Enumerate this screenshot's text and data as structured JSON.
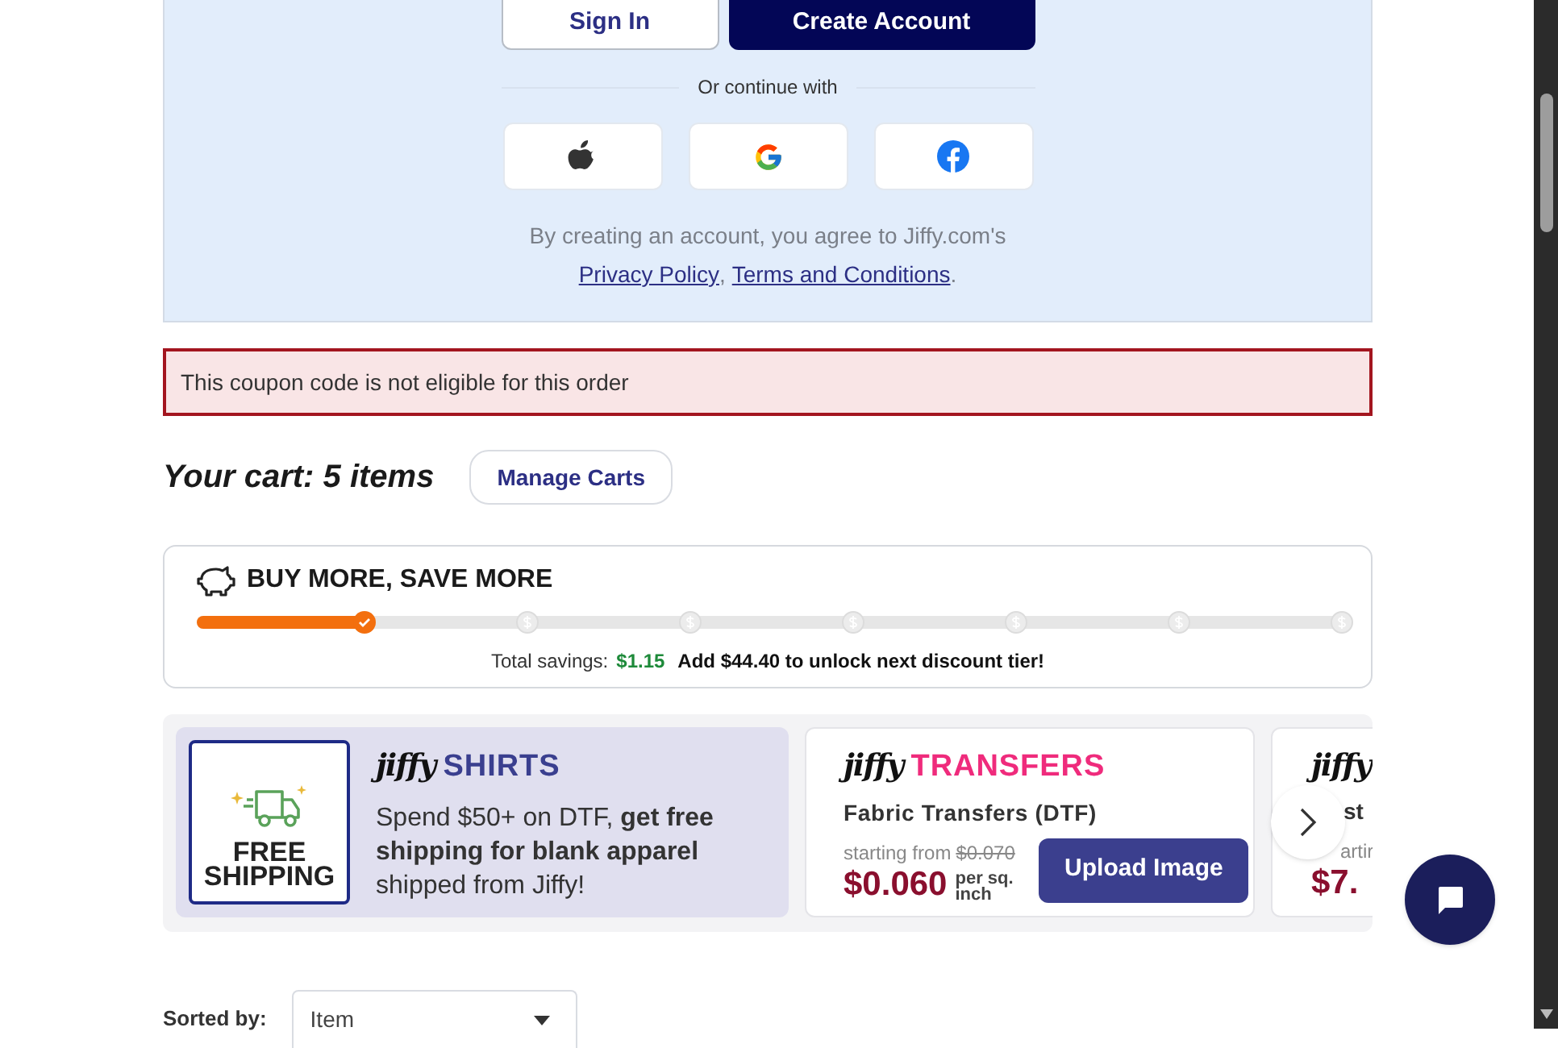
{
  "auth_panel": {
    "buttons": [
      {
        "label": "Sign In",
        "kind": "secondary"
      },
      {
        "label": "Create Account",
        "kind": "primary"
      }
    ],
    "divider_text": "Or continue with",
    "social_buttons": [
      {
        "kind": "apple"
      },
      {
        "kind": "google"
      },
      {
        "kind": "facebook"
      }
    ],
    "terms": {
      "text": "By creating an account, you agree to Jiffy.com's",
      "links": [
        "Privacy Policy",
        "Terms and Conditions"
      ],
      "separator": ",",
      "end": "."
    }
  },
  "coupon_error": "This coupon code is not eligible for this order",
  "cart": {
    "title": "Your cart: 5 items",
    "manage_button": "Manage Carts"
  },
  "savings": {
    "title": "BUY MORE, SAVE MORE",
    "level": 0.146,
    "tiers": [
      {
        "reached": true
      },
      {
        "reached": false
      },
      {
        "reached": false
      },
      {
        "reached": false
      },
      {
        "reached": false
      },
      {
        "reached": false
      },
      {
        "reached": false
      }
    ],
    "total_label": "Total savings:",
    "total_value": "$1.15",
    "next_tier": "Add $44.40 to unlock next discount tier!"
  },
  "promos": [
    {
      "kind": "shipping",
      "badge": [
        "FREE",
        "SHIPPING"
      ],
      "brand": "jiffy",
      "product": "SHIRTS",
      "text": "Spend $50+ on DTF, **get free shipping for blank apparel** shipped from Jiffy!"
    },
    {
      "kind": "product",
      "brand": "jiffy",
      "product": "TRANSFERS",
      "name": "Fabric Transfers (DTF)",
      "from_label": "starting from",
      "old_price": "$0.070",
      "price": "$0.060",
      "unit": "per sq. inch",
      "button": "Upload Image"
    },
    {
      "kind": "partial",
      "brand": "jiffy",
      "name": "st",
      "from_label": "artir",
      "price": "$7."
    }
  ],
  "sort": {
    "label": "Sorted by:",
    "value": "Item"
  }
}
